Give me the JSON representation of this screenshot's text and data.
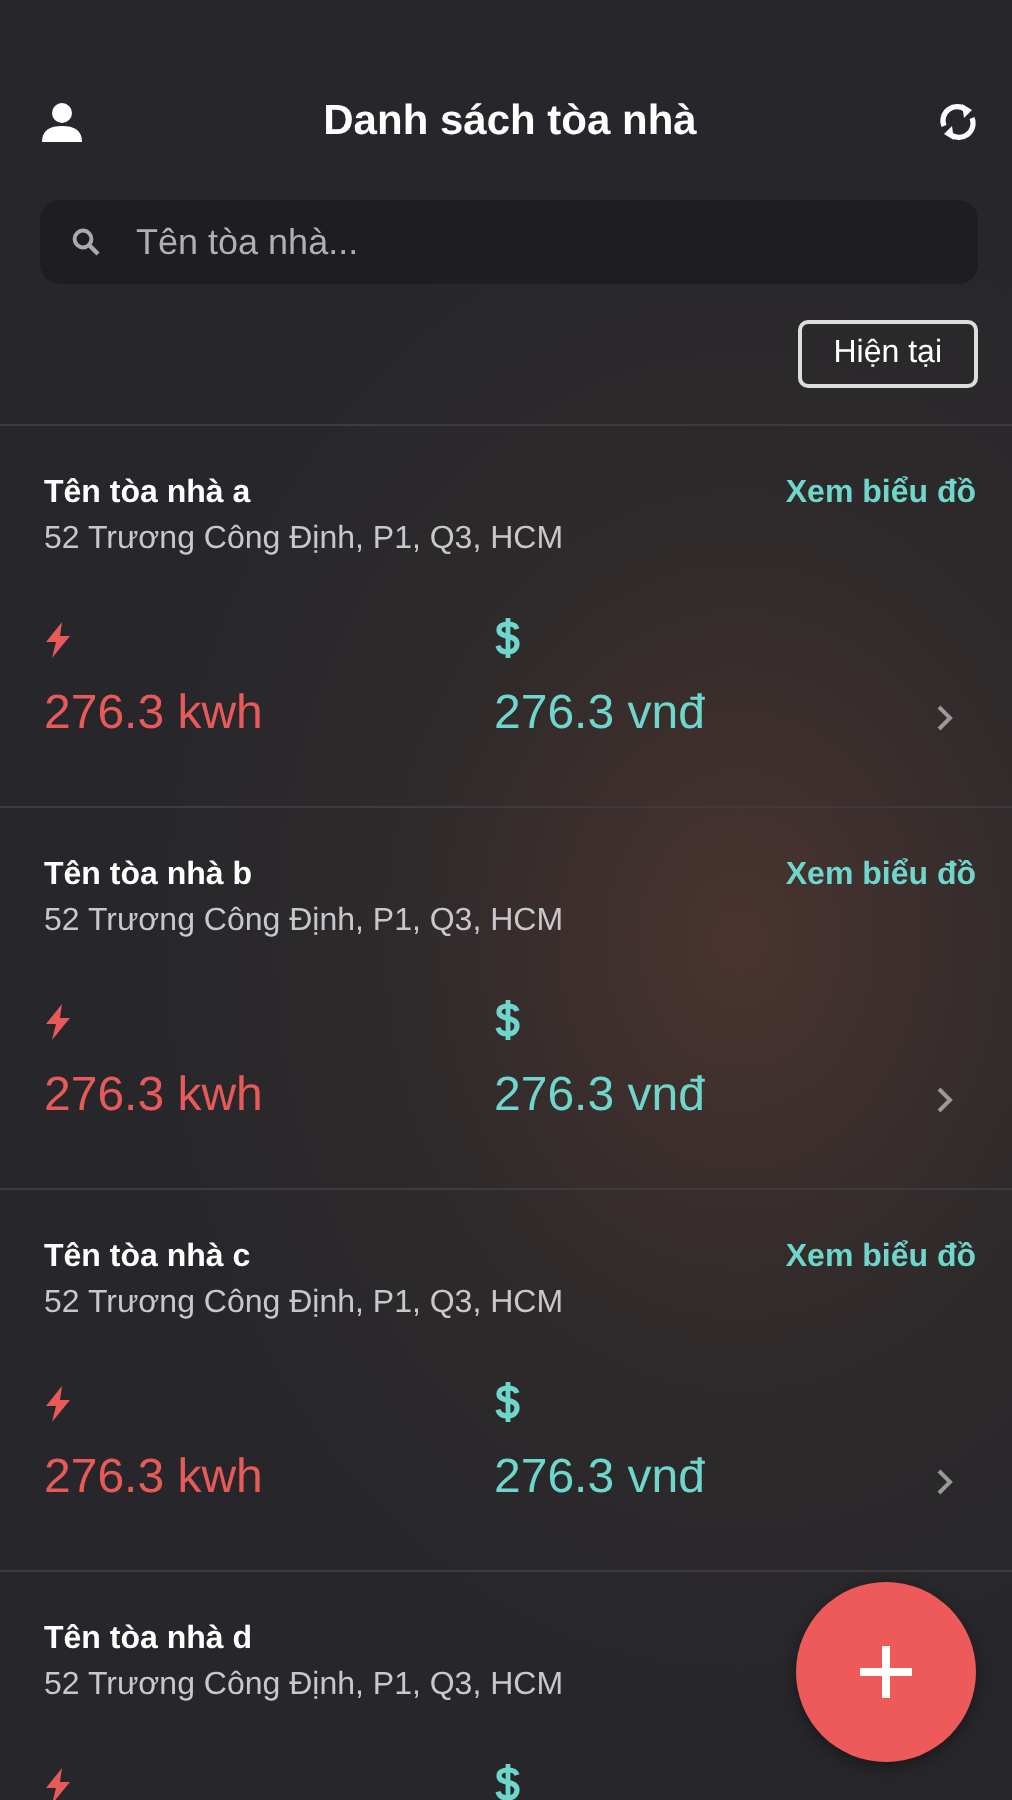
{
  "header": {
    "title": "Danh sách tòa nhà"
  },
  "search": {
    "placeholder": "Tên tòa nhà..."
  },
  "filter_button": {
    "label": "Hiện tại"
  },
  "buildings": [
    {
      "name": "Tên tòa nhà a",
      "address": "52 Trương Công Định, P1, Q3, HCM",
      "chart_link": "Xem biểu đồ",
      "energy": "276.3 kwh",
      "cost": "276.3 vnđ"
    },
    {
      "name": "Tên tòa nhà b",
      "address": "52 Trương Công Định, P1, Q3, HCM",
      "chart_link": "Xem biểu đồ",
      "energy": "276.3 kwh",
      "cost": "276.3 vnđ"
    },
    {
      "name": "Tên tòa nhà c",
      "address": "52 Trương Công Định, P1, Q3, HCM",
      "chart_link": "Xem biểu đồ",
      "energy": "276.3 kwh",
      "cost": "276.3 vnđ"
    },
    {
      "name": "Tên tòa nhà d",
      "address": "52 Trương Công Định, P1, Q3, HCM"
    }
  ]
}
